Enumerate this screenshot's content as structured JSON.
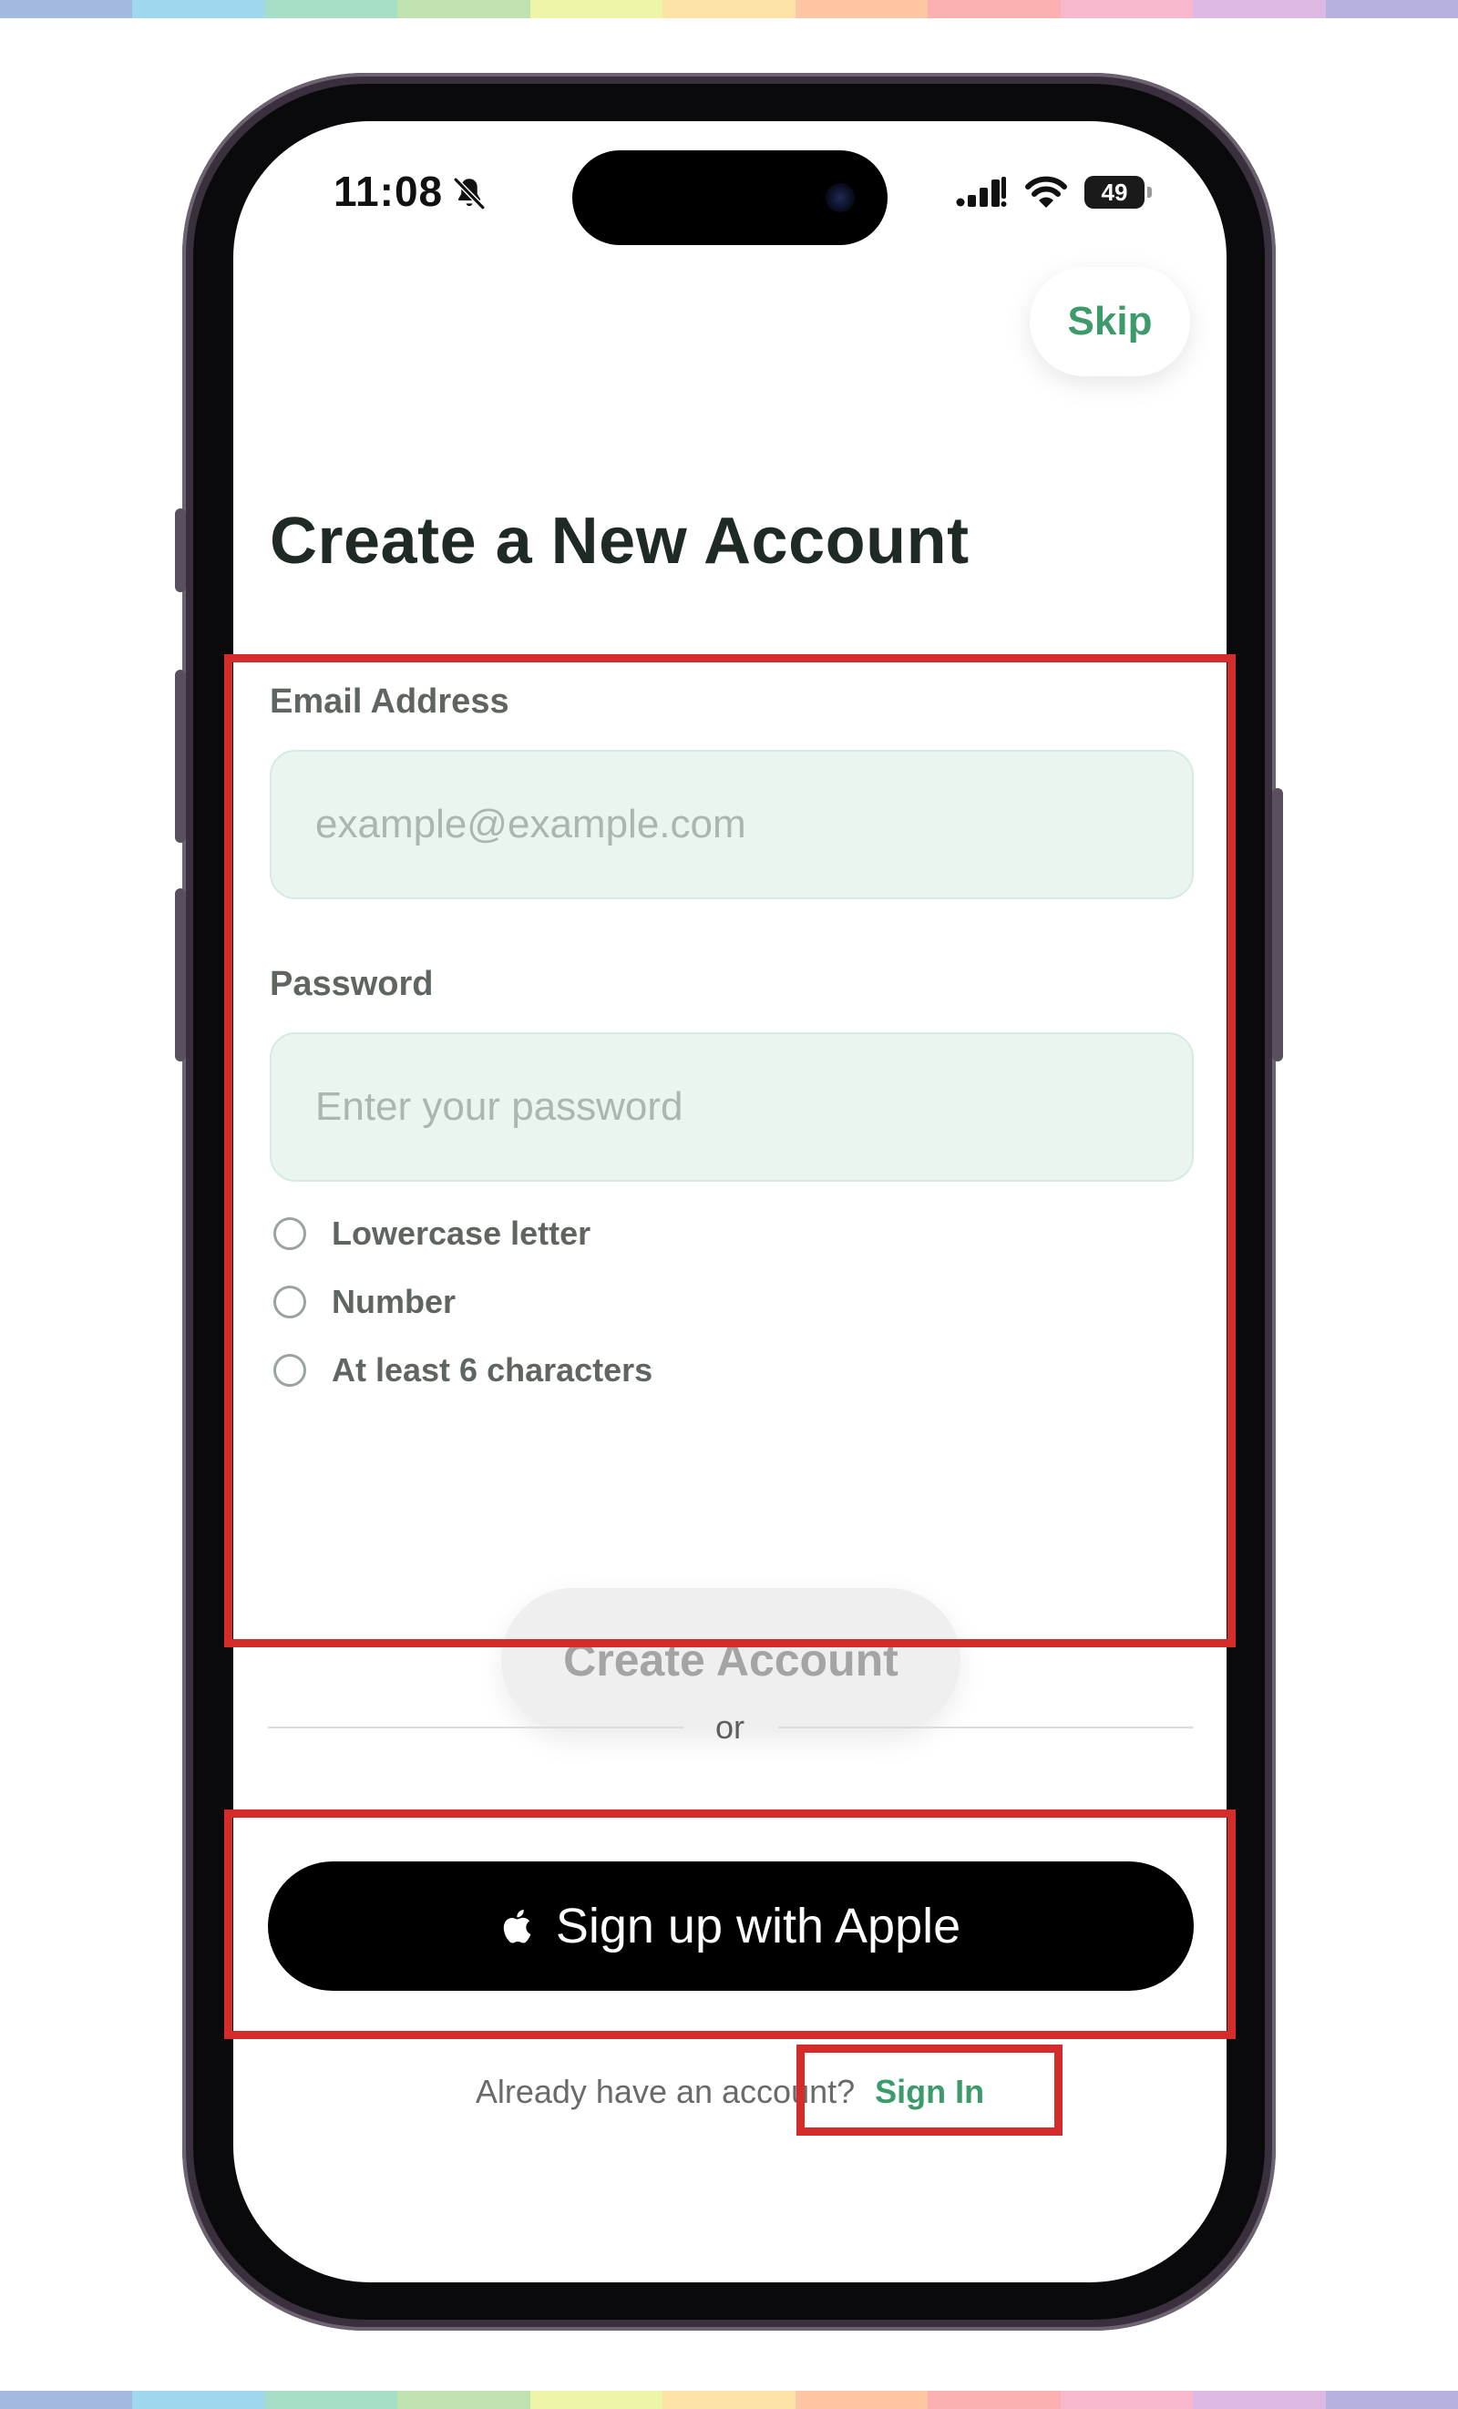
{
  "status_bar": {
    "time": "11:08",
    "battery_level": "49"
  },
  "header": {
    "skip_label": "Skip",
    "title": "Create a New Account"
  },
  "form": {
    "email": {
      "label": "Email Address",
      "placeholder": "example@example.com",
      "value": ""
    },
    "password": {
      "label": "Password",
      "placeholder": "Enter your password",
      "value": ""
    },
    "requirements": [
      {
        "label": "Lowercase letter",
        "met": false
      },
      {
        "label": "Number",
        "met": false
      },
      {
        "label": "At least 6 characters",
        "met": false
      }
    ],
    "submit_label": "Create Account"
  },
  "divider": {
    "text": "or"
  },
  "apple_signup": {
    "label": "Sign up with Apple",
    "icon": "apple-logo-icon"
  },
  "footer": {
    "prompt": "Already have an account?",
    "signin_label": "Sign In"
  },
  "colors": {
    "accent": "#3d9a6b",
    "input_bg": "#eaf5ef",
    "highlight": "#d42b2b",
    "title": "#1f2a24",
    "rainbow": [
      "#a3b9df",
      "#9fd8ec",
      "#a7dfc6",
      "#bfe2b0",
      "#eef5a8",
      "#fde3a5",
      "#fec6a2",
      "#fbb1b1",
      "#f7b7cd",
      "#dcb8e2",
      "#b7b1df"
    ]
  }
}
